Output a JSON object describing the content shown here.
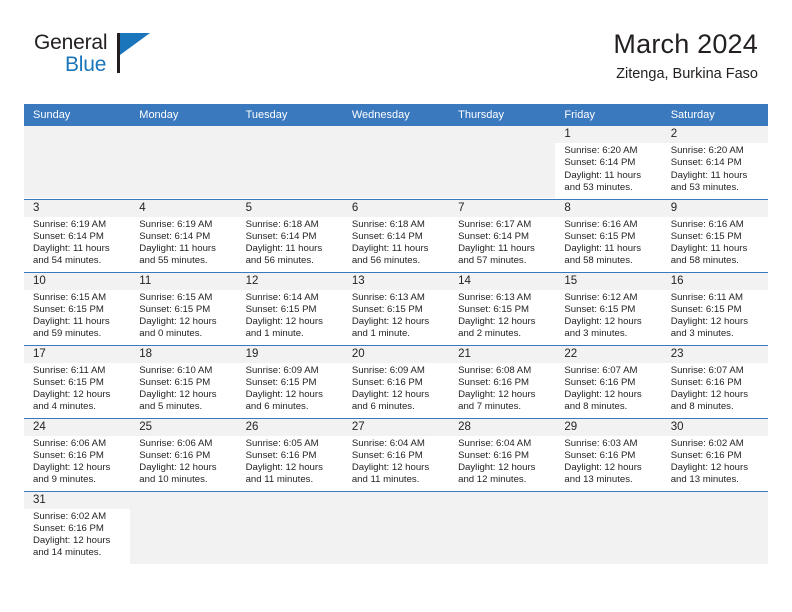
{
  "brand": {
    "name_top": "General",
    "name_bottom": "Blue",
    "accent_color": "#1b75bb"
  },
  "header": {
    "title": "March 2024",
    "subtitle": "Zitenga, Burkina Faso"
  },
  "calendar": {
    "header_color": "#3b79bf",
    "daynum_band_color": "#f2f2f2",
    "weekday_headers": [
      "Sunday",
      "Monday",
      "Tuesday",
      "Wednesday",
      "Thursday",
      "Friday",
      "Saturday"
    ],
    "labels": {
      "sunrise_prefix": "Sunrise: ",
      "sunset_prefix": "Sunset: ",
      "daylight_prefix": "Daylight: "
    },
    "weeks": [
      [
        {
          "empty": true
        },
        {
          "empty": true
        },
        {
          "empty": true
        },
        {
          "empty": true
        },
        {
          "empty": true
        },
        {
          "day": "1",
          "sunrise": "Sunrise: 6:20 AM",
          "sunset": "Sunset: 6:14 PM",
          "daylight": "Daylight: 11 hours and 53 minutes."
        },
        {
          "day": "2",
          "sunrise": "Sunrise: 6:20 AM",
          "sunset": "Sunset: 6:14 PM",
          "daylight": "Daylight: 11 hours and 53 minutes."
        }
      ],
      [
        {
          "day": "3",
          "sunrise": "Sunrise: 6:19 AM",
          "sunset": "Sunset: 6:14 PM",
          "daylight": "Daylight: 11 hours and 54 minutes."
        },
        {
          "day": "4",
          "sunrise": "Sunrise: 6:19 AM",
          "sunset": "Sunset: 6:14 PM",
          "daylight": "Daylight: 11 hours and 55 minutes."
        },
        {
          "day": "5",
          "sunrise": "Sunrise: 6:18 AM",
          "sunset": "Sunset: 6:14 PM",
          "daylight": "Daylight: 11 hours and 56 minutes."
        },
        {
          "day": "6",
          "sunrise": "Sunrise: 6:18 AM",
          "sunset": "Sunset: 6:14 PM",
          "daylight": "Daylight: 11 hours and 56 minutes."
        },
        {
          "day": "7",
          "sunrise": "Sunrise: 6:17 AM",
          "sunset": "Sunset: 6:14 PM",
          "daylight": "Daylight: 11 hours and 57 minutes."
        },
        {
          "day": "8",
          "sunrise": "Sunrise: 6:16 AM",
          "sunset": "Sunset: 6:15 PM",
          "daylight": "Daylight: 11 hours and 58 minutes."
        },
        {
          "day": "9",
          "sunrise": "Sunrise: 6:16 AM",
          "sunset": "Sunset: 6:15 PM",
          "daylight": "Daylight: 11 hours and 58 minutes."
        }
      ],
      [
        {
          "day": "10",
          "sunrise": "Sunrise: 6:15 AM",
          "sunset": "Sunset: 6:15 PM",
          "daylight": "Daylight: 11 hours and 59 minutes."
        },
        {
          "day": "11",
          "sunrise": "Sunrise: 6:15 AM",
          "sunset": "Sunset: 6:15 PM",
          "daylight": "Daylight: 12 hours and 0 minutes."
        },
        {
          "day": "12",
          "sunrise": "Sunrise: 6:14 AM",
          "sunset": "Sunset: 6:15 PM",
          "daylight": "Daylight: 12 hours and 1 minute."
        },
        {
          "day": "13",
          "sunrise": "Sunrise: 6:13 AM",
          "sunset": "Sunset: 6:15 PM",
          "daylight": "Daylight: 12 hours and 1 minute."
        },
        {
          "day": "14",
          "sunrise": "Sunrise: 6:13 AM",
          "sunset": "Sunset: 6:15 PM",
          "daylight": "Daylight: 12 hours and 2 minutes."
        },
        {
          "day": "15",
          "sunrise": "Sunrise: 6:12 AM",
          "sunset": "Sunset: 6:15 PM",
          "daylight": "Daylight: 12 hours and 3 minutes."
        },
        {
          "day": "16",
          "sunrise": "Sunrise: 6:11 AM",
          "sunset": "Sunset: 6:15 PM",
          "daylight": "Daylight: 12 hours and 3 minutes."
        }
      ],
      [
        {
          "day": "17",
          "sunrise": "Sunrise: 6:11 AM",
          "sunset": "Sunset: 6:15 PM",
          "daylight": "Daylight: 12 hours and 4 minutes."
        },
        {
          "day": "18",
          "sunrise": "Sunrise: 6:10 AM",
          "sunset": "Sunset: 6:15 PM",
          "daylight": "Daylight: 12 hours and 5 minutes."
        },
        {
          "day": "19",
          "sunrise": "Sunrise: 6:09 AM",
          "sunset": "Sunset: 6:15 PM",
          "daylight": "Daylight: 12 hours and 6 minutes."
        },
        {
          "day": "20",
          "sunrise": "Sunrise: 6:09 AM",
          "sunset": "Sunset: 6:16 PM",
          "daylight": "Daylight: 12 hours and 6 minutes."
        },
        {
          "day": "21",
          "sunrise": "Sunrise: 6:08 AM",
          "sunset": "Sunset: 6:16 PM",
          "daylight": "Daylight: 12 hours and 7 minutes."
        },
        {
          "day": "22",
          "sunrise": "Sunrise: 6:07 AM",
          "sunset": "Sunset: 6:16 PM",
          "daylight": "Daylight: 12 hours and 8 minutes."
        },
        {
          "day": "23",
          "sunrise": "Sunrise: 6:07 AM",
          "sunset": "Sunset: 6:16 PM",
          "daylight": "Daylight: 12 hours and 8 minutes."
        }
      ],
      [
        {
          "day": "24",
          "sunrise": "Sunrise: 6:06 AM",
          "sunset": "Sunset: 6:16 PM",
          "daylight": "Daylight: 12 hours and 9 minutes."
        },
        {
          "day": "25",
          "sunrise": "Sunrise: 6:06 AM",
          "sunset": "Sunset: 6:16 PM",
          "daylight": "Daylight: 12 hours and 10 minutes."
        },
        {
          "day": "26",
          "sunrise": "Sunrise: 6:05 AM",
          "sunset": "Sunset: 6:16 PM",
          "daylight": "Daylight: 12 hours and 11 minutes."
        },
        {
          "day": "27",
          "sunrise": "Sunrise: 6:04 AM",
          "sunset": "Sunset: 6:16 PM",
          "daylight": "Daylight: 12 hours and 11 minutes."
        },
        {
          "day": "28",
          "sunrise": "Sunrise: 6:04 AM",
          "sunset": "Sunset: 6:16 PM",
          "daylight": "Daylight: 12 hours and 12 minutes."
        },
        {
          "day": "29",
          "sunrise": "Sunrise: 6:03 AM",
          "sunset": "Sunset: 6:16 PM",
          "daylight": "Daylight: 12 hours and 13 minutes."
        },
        {
          "day": "30",
          "sunrise": "Sunrise: 6:02 AM",
          "sunset": "Sunset: 6:16 PM",
          "daylight": "Daylight: 12 hours and 13 minutes."
        }
      ],
      [
        {
          "day": "31",
          "sunrise": "Sunrise: 6:02 AM",
          "sunset": "Sunset: 6:16 PM",
          "daylight": "Daylight: 12 hours and 14 minutes."
        },
        {
          "empty": true
        },
        {
          "empty": true
        },
        {
          "empty": true
        },
        {
          "empty": true
        },
        {
          "empty": true
        },
        {
          "empty": true
        }
      ]
    ]
  }
}
